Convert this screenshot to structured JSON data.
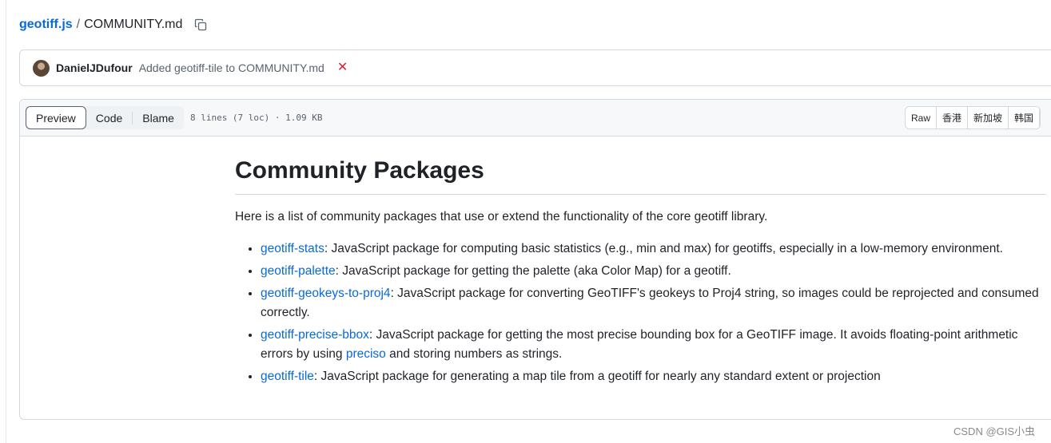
{
  "breadcrumb": {
    "repo": "geotiff.js",
    "separator": "/",
    "file": "COMMUNITY.md",
    "copy_icon": "copy-icon"
  },
  "commit": {
    "author": "DanielJDufour",
    "message": "Added geotiff-tile to COMMUNITY.md",
    "status_icon": "x-icon",
    "status_color": "#d1242f"
  },
  "file_header": {
    "tabs": [
      {
        "label": "Preview",
        "active": true
      },
      {
        "label": "Code",
        "active": false
      },
      {
        "label": "Blame",
        "active": false
      }
    ],
    "meta": "8 lines (7 loc) · 1.09 KB",
    "actions": [
      "Raw",
      "香港",
      "新加坡",
      "韩国"
    ]
  },
  "markdown": {
    "title": "Community Packages",
    "intro": "Here is a list of community packages that use or extend the functionality of the core geotiff library.",
    "items": [
      {
        "link": "geotiff-stats",
        "text": ": JavaScript package for computing basic statistics (e.g., min and max) for geotiffs, especially in a low-memory environment."
      },
      {
        "link": "geotiff-palette",
        "text": ": JavaScript package for getting the palette (aka Color Map) for a geotiff."
      },
      {
        "link": "geotiff-geokeys-to-proj4",
        "text": ": JavaScript package for converting GeoTIFF's geokeys to Proj4 string, so images could be reprojected and consumed correctly."
      },
      {
        "link": "geotiff-precise-bbox",
        "text": ": JavaScript package for getting the most precise bounding box for a GeoTIFF image. It avoids floating-point arithmetic errors by using ",
        "inline_link": "preciso",
        "text_after": " and storing numbers as strings."
      },
      {
        "link": "geotiff-tile",
        "text": ": JavaScript package for generating a map tile from a geotiff for nearly any standard extent or projection"
      }
    ]
  },
  "watermark": "CSDN @GIS小虫",
  "colors": {
    "link": "#0969da",
    "border": "#d1d9e0",
    "header_bg": "#f6f8fa"
  }
}
